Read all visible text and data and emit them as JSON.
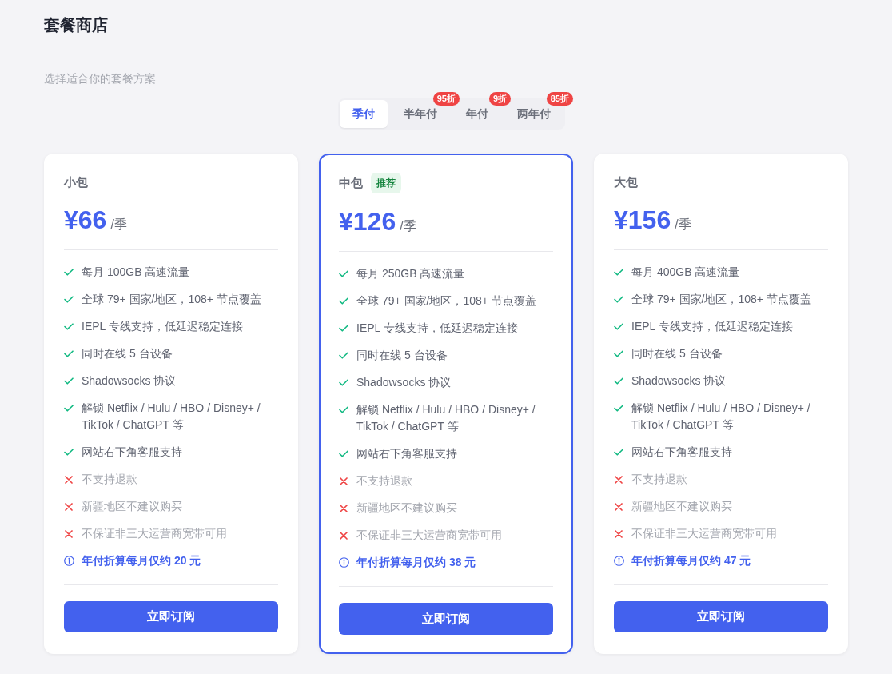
{
  "page": {
    "title": "套餐商店",
    "subtitle": "选择适合你的套餐方案"
  },
  "billing_tabs": [
    {
      "label": "季付",
      "selected": true
    },
    {
      "label": "半年付",
      "selected": false,
      "badge": "95折"
    },
    {
      "label": "年付",
      "selected": false,
      "badge": "9折"
    },
    {
      "label": "两年付",
      "selected": false,
      "badge": "85折"
    }
  ],
  "plans": [
    {
      "name": "小包",
      "featured": false,
      "price": "¥66",
      "period": "/季",
      "features": [
        {
          "kind": "included",
          "text": "每月 100GB 高速流量"
        },
        {
          "kind": "included",
          "text": "全球 79+ 国家/地区，108+ 节点覆盖"
        },
        {
          "kind": "included",
          "text": "IEPL 专线支持，低延迟稳定连接"
        },
        {
          "kind": "included",
          "text": "同时在线 5 台设备"
        },
        {
          "kind": "included",
          "text": "Shadowsocks 协议"
        },
        {
          "kind": "included",
          "text": "解锁 Netflix / Hulu / HBO / Disney+ / TikTok / ChatGPT 等"
        },
        {
          "kind": "included",
          "text": "网站右下角客服支持"
        },
        {
          "kind": "excluded",
          "text": "不支持退款"
        },
        {
          "kind": "excluded",
          "text": "新疆地区不建议购买"
        },
        {
          "kind": "excluded",
          "text": "不保证非三大运营商宽带可用"
        },
        {
          "kind": "note",
          "text": "年付折算每月仅约 20 元"
        }
      ],
      "button": "立即订阅"
    },
    {
      "name": "中包",
      "badge": "推荐",
      "featured": true,
      "price": "¥126",
      "period": "/季",
      "features": [
        {
          "kind": "included",
          "text": "每月 250GB 高速流量"
        },
        {
          "kind": "included",
          "text": "全球 79+ 国家/地区，108+ 节点覆盖"
        },
        {
          "kind": "included",
          "text": "IEPL 专线支持，低延迟稳定连接"
        },
        {
          "kind": "included",
          "text": "同时在线 5 台设备"
        },
        {
          "kind": "included",
          "text": "Shadowsocks 协议"
        },
        {
          "kind": "included",
          "text": "解锁 Netflix / Hulu / HBO / Disney+ / TikTok / ChatGPT 等"
        },
        {
          "kind": "included",
          "text": "网站右下角客服支持"
        },
        {
          "kind": "excluded",
          "text": "不支持退款"
        },
        {
          "kind": "excluded",
          "text": "新疆地区不建议购买"
        },
        {
          "kind": "excluded",
          "text": "不保证非三大运营商宽带可用"
        },
        {
          "kind": "note",
          "text": "年付折算每月仅约 38 元"
        }
      ],
      "button": "立即订阅"
    },
    {
      "name": "大包",
      "featured": false,
      "price": "¥156",
      "period": "/季",
      "features": [
        {
          "kind": "included",
          "text": "每月 400GB 高速流量"
        },
        {
          "kind": "included",
          "text": "全球 79+ 国家/地区，108+ 节点覆盖"
        },
        {
          "kind": "included",
          "text": "IEPL 专线支持，低延迟稳定连接"
        },
        {
          "kind": "included",
          "text": "同时在线 5 台设备"
        },
        {
          "kind": "included",
          "text": "Shadowsocks 协议"
        },
        {
          "kind": "included",
          "text": "解锁 Netflix / Hulu / HBO / Disney+ / TikTok / ChatGPT 等"
        },
        {
          "kind": "included",
          "text": "网站右下角客服支持"
        },
        {
          "kind": "excluded",
          "text": "不支持退款"
        },
        {
          "kind": "excluded",
          "text": "新疆地区不建议购买"
        },
        {
          "kind": "excluded",
          "text": "不保证非三大运营商宽带可用"
        },
        {
          "kind": "note",
          "text": "年付折算每月仅约 47 元"
        }
      ],
      "button": "立即订阅"
    }
  ]
}
